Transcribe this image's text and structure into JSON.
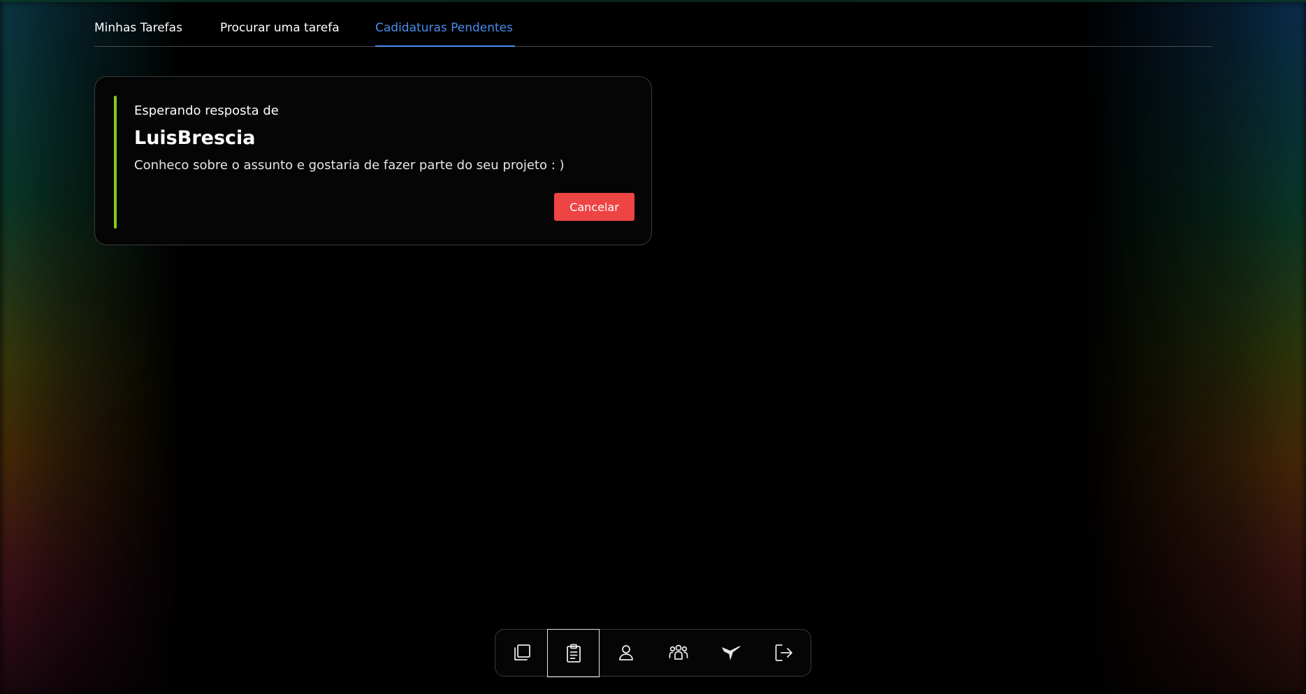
{
  "tabs": {
    "items": [
      {
        "label": "Minhas Tarefas",
        "active": false
      },
      {
        "label": "Procurar uma tarefa",
        "active": false
      },
      {
        "label": "Cadidaturas Pendentes",
        "active": true
      }
    ],
    "active_color": "#4a8cf0"
  },
  "card": {
    "subtitle": "Esperando resposta de",
    "name": "LuisBrescia",
    "message": "Conheco sobre o assunto e gostaria de fazer parte do seu projeto : )",
    "cancel_label": "Cancelar",
    "accent_color": "#84cc16",
    "cancel_color": "#ef4444"
  },
  "dock": {
    "items": [
      {
        "icon": "library-icon",
        "active": false
      },
      {
        "icon": "clipboard-icon",
        "active": true
      },
      {
        "icon": "user-icon",
        "active": false
      },
      {
        "icon": "users-group-icon",
        "active": false
      },
      {
        "icon": "hummingbird-logo-icon",
        "active": false
      },
      {
        "icon": "logout-icon",
        "active": false
      }
    ]
  }
}
